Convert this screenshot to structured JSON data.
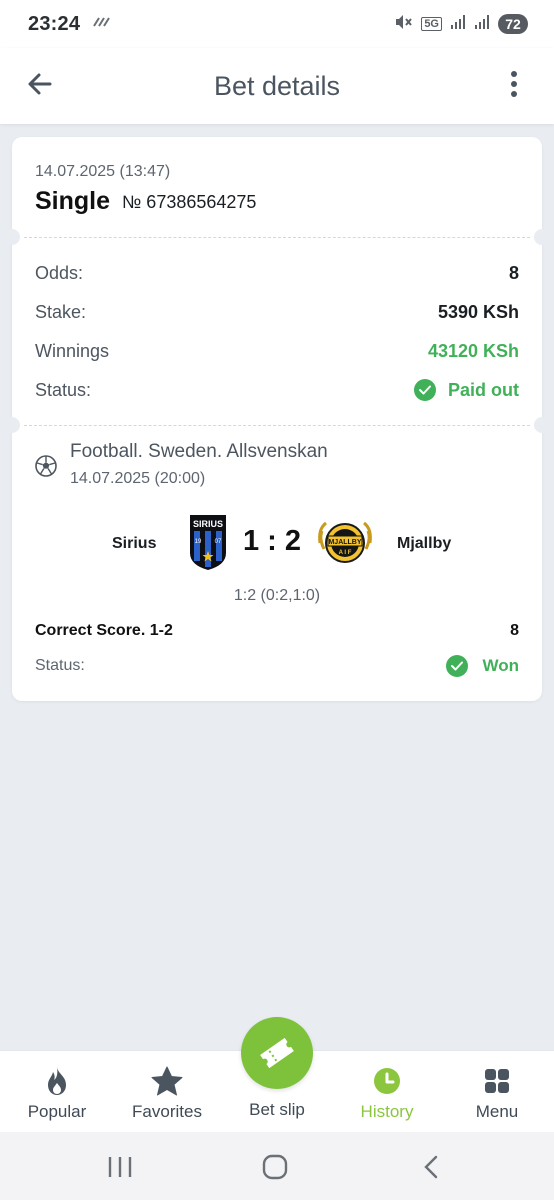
{
  "status_bar": {
    "time": "23:24",
    "network": "5G",
    "battery": "72"
  },
  "header": {
    "title": "Bet details"
  },
  "bet": {
    "datetime": "14.07.2025 (13:47)",
    "type": "Single",
    "number": "№ 67386564275",
    "odds_label": "Odds:",
    "odds_value": "8",
    "stake_label": "Stake:",
    "stake_value": "5390 KSh",
    "winnings_label": "Winnings",
    "winnings_value": "43120 KSh",
    "status_label": "Status:",
    "status_value": "Paid out"
  },
  "event": {
    "league": "Football. Sweden. Allsvenskan",
    "datetime": "14.07.2025 (20:00)",
    "home_team": "Sirius",
    "home_logo_text": "SIRIUS",
    "home_logo_years": [
      "19",
      "07"
    ],
    "away_team": "Mjallby",
    "away_logo_text": "MJALLBY",
    "away_logo_sub": "A I F",
    "score": "1 : 2",
    "score_detail": "1:2 (0:2,1:0)",
    "pick": "Correct Score. 1-2",
    "pick_odds": "8",
    "status_label": "Status:",
    "status_value": "Won"
  },
  "bottom_nav": {
    "items": [
      {
        "label": "Popular",
        "icon": "flame-icon"
      },
      {
        "label": "Favorites",
        "icon": "star-icon"
      },
      {
        "label": "Bet slip",
        "icon": "ticket-icon"
      },
      {
        "label": "History",
        "icon": "clock-icon",
        "active": true
      },
      {
        "label": "Menu",
        "icon": "grid-icon"
      }
    ]
  },
  "colors": {
    "accent_green": "#41b159",
    "nav_active": "#8cc63f",
    "betslip_button": "#7dc23a",
    "background": "#e9edf2"
  }
}
